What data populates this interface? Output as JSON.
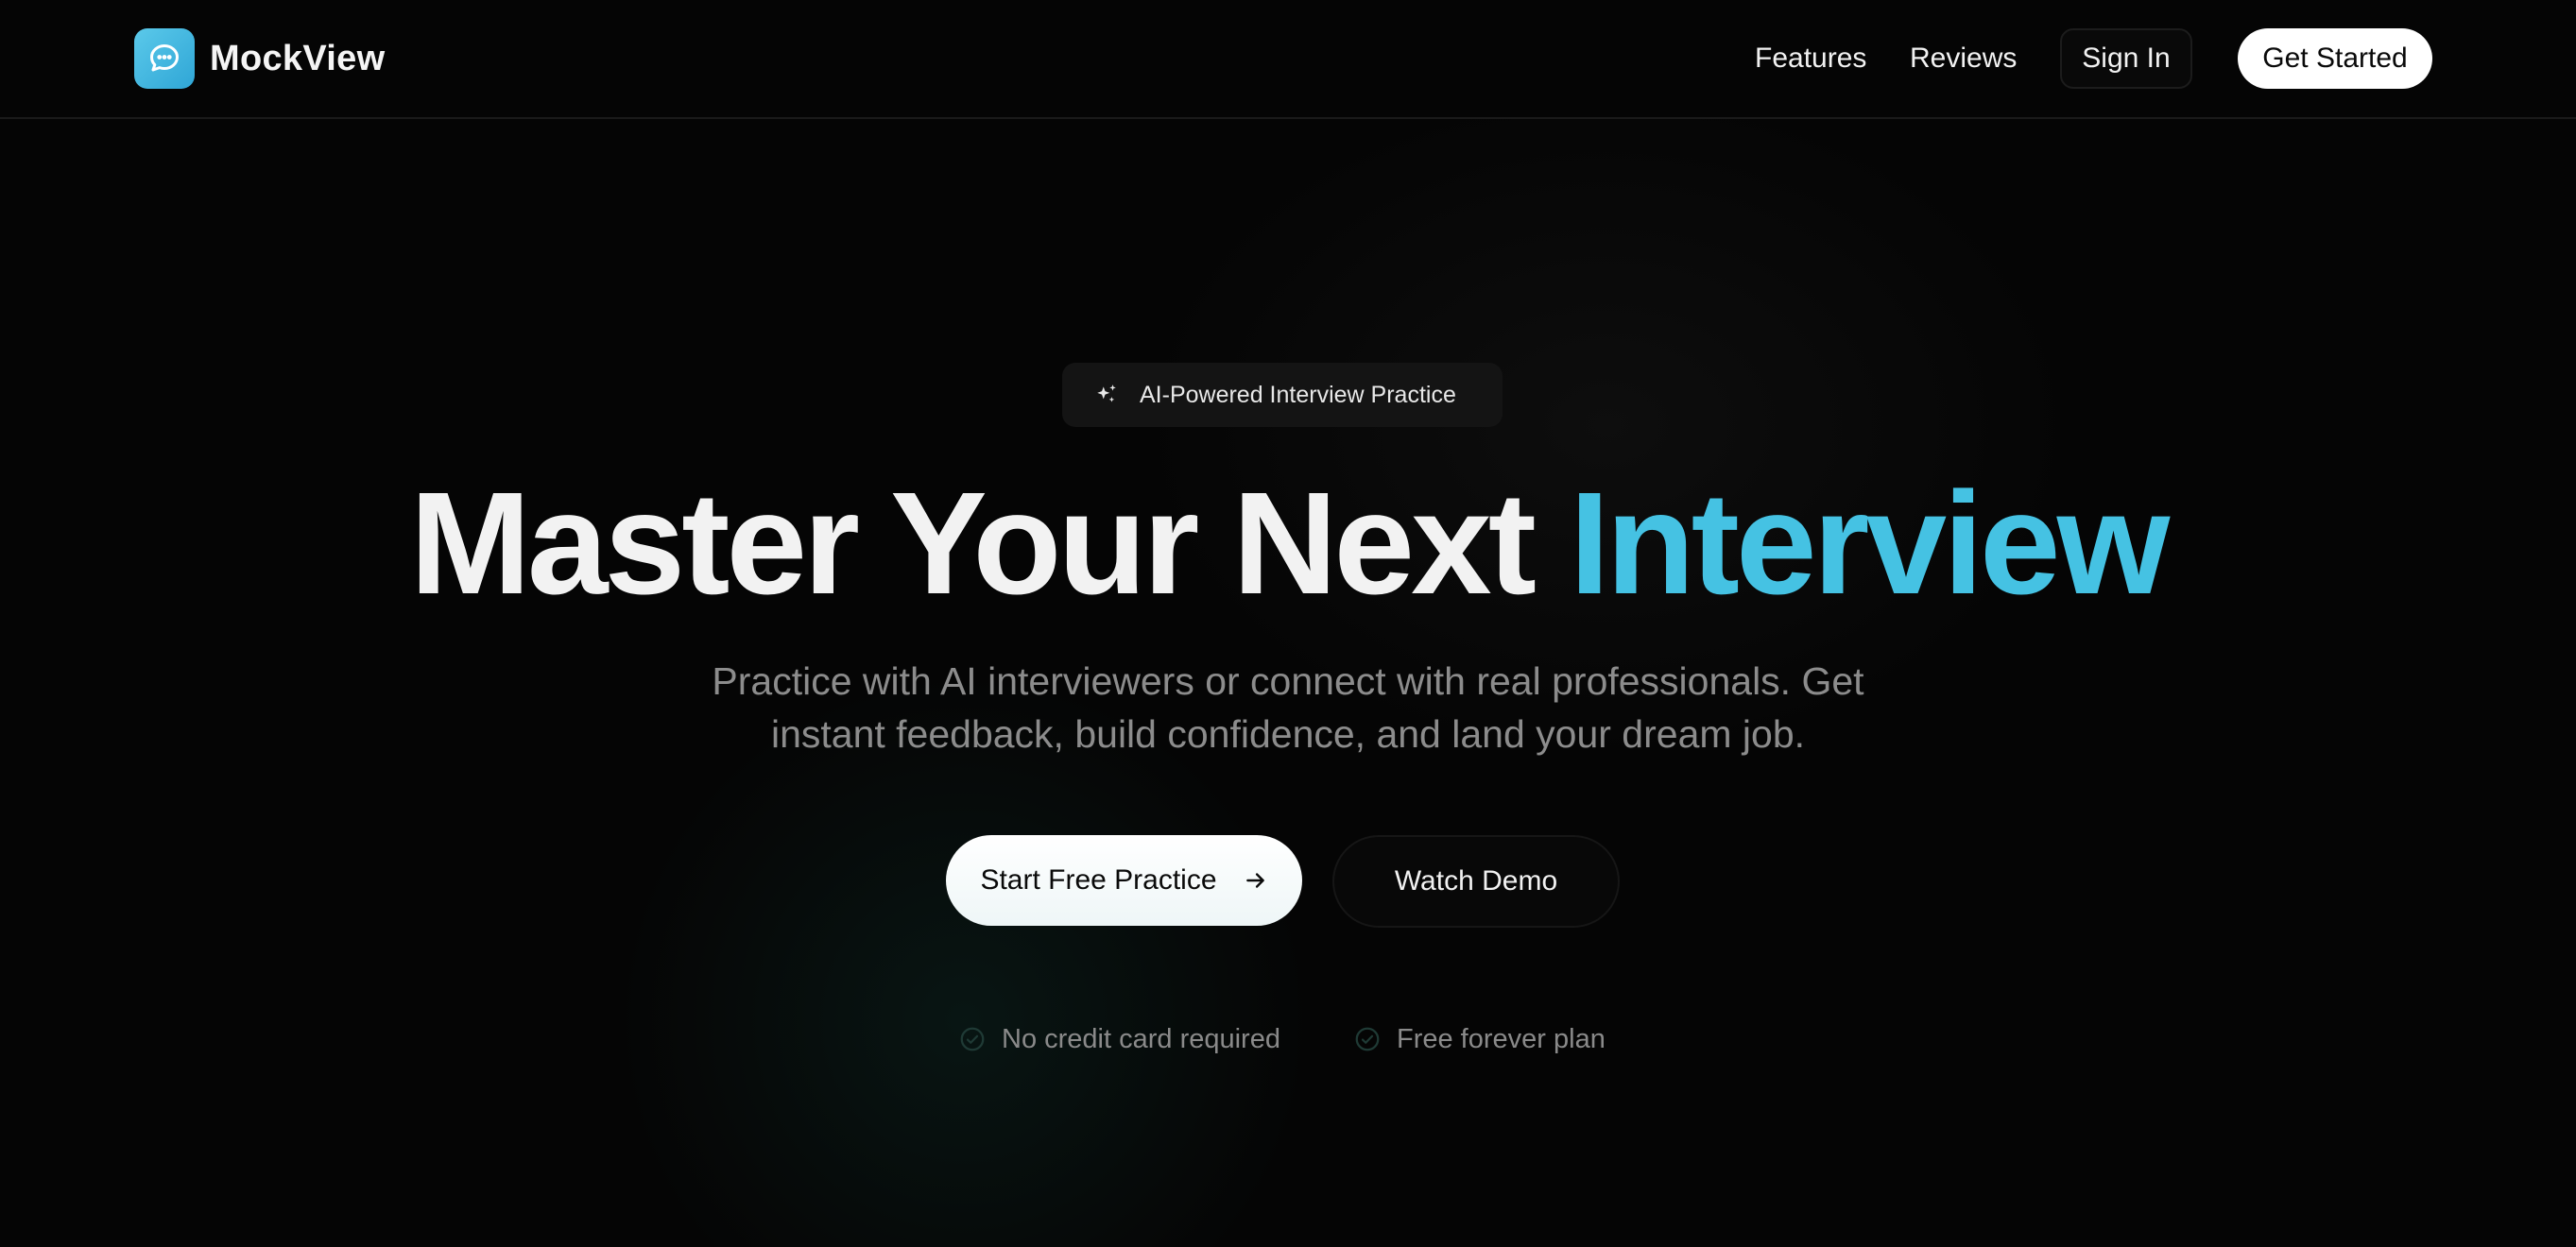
{
  "nav": {
    "brand": "MockView",
    "logo_icon": "chat-bubble-icon",
    "links": [
      "Features",
      "Reviews"
    ],
    "sign_in": "Sign In",
    "get_started": "Get Started"
  },
  "hero": {
    "badge_icon": "sparkles-icon",
    "badge": "AI-Powered Interview Practice",
    "headline_white": "Master Your Next",
    "headline_accent": "Interview",
    "subline_1": "Practice with AI interviewers or connect with real professionals. Get",
    "subline_2": "instant feedback, build confidence, and land your dream job.",
    "cta_primary": "Start Free Practice",
    "cta_primary_icon": "arrow-right-icon",
    "cta_secondary": "Watch Demo",
    "perks": [
      "No credit card required",
      "Free forever plan"
    ],
    "perk_icon": "check-circle-icon"
  },
  "colors": {
    "background": "#050505",
    "accent": "#45c2e3",
    "logo_gradient_start": "#5bc9ea",
    "logo_gradient_end": "#2fa6d6",
    "muted_text": "#8c8c8c"
  }
}
